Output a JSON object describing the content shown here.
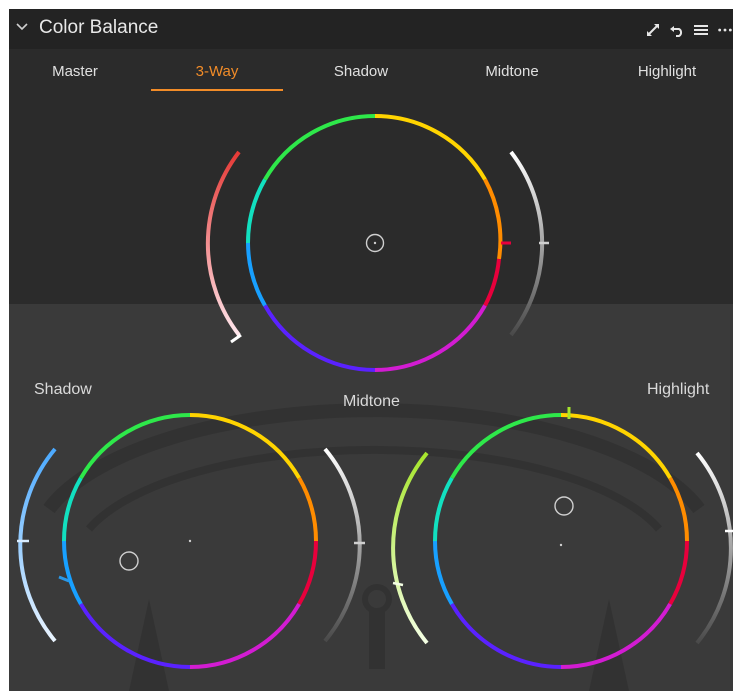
{
  "panel": {
    "title": "Color Balance"
  },
  "header_tools": [
    {
      "name": "expand-icon"
    },
    {
      "name": "reset-icon"
    },
    {
      "name": "menu-icon"
    },
    {
      "name": "more-icon"
    }
  ],
  "tabs": {
    "items": [
      "Master",
      "3-Way",
      "Shadow",
      "Midtone",
      "Highlight"
    ],
    "active": "3-Way"
  },
  "wheels": {
    "shadow_label": "Shadow",
    "midtone_label": "Midtone",
    "highlight_label": "Highlight"
  },
  "colors": {
    "accent": "#f28c28",
    "panel_bg": "#2b2b2b",
    "lower_bg": "#3a3a3a"
  }
}
